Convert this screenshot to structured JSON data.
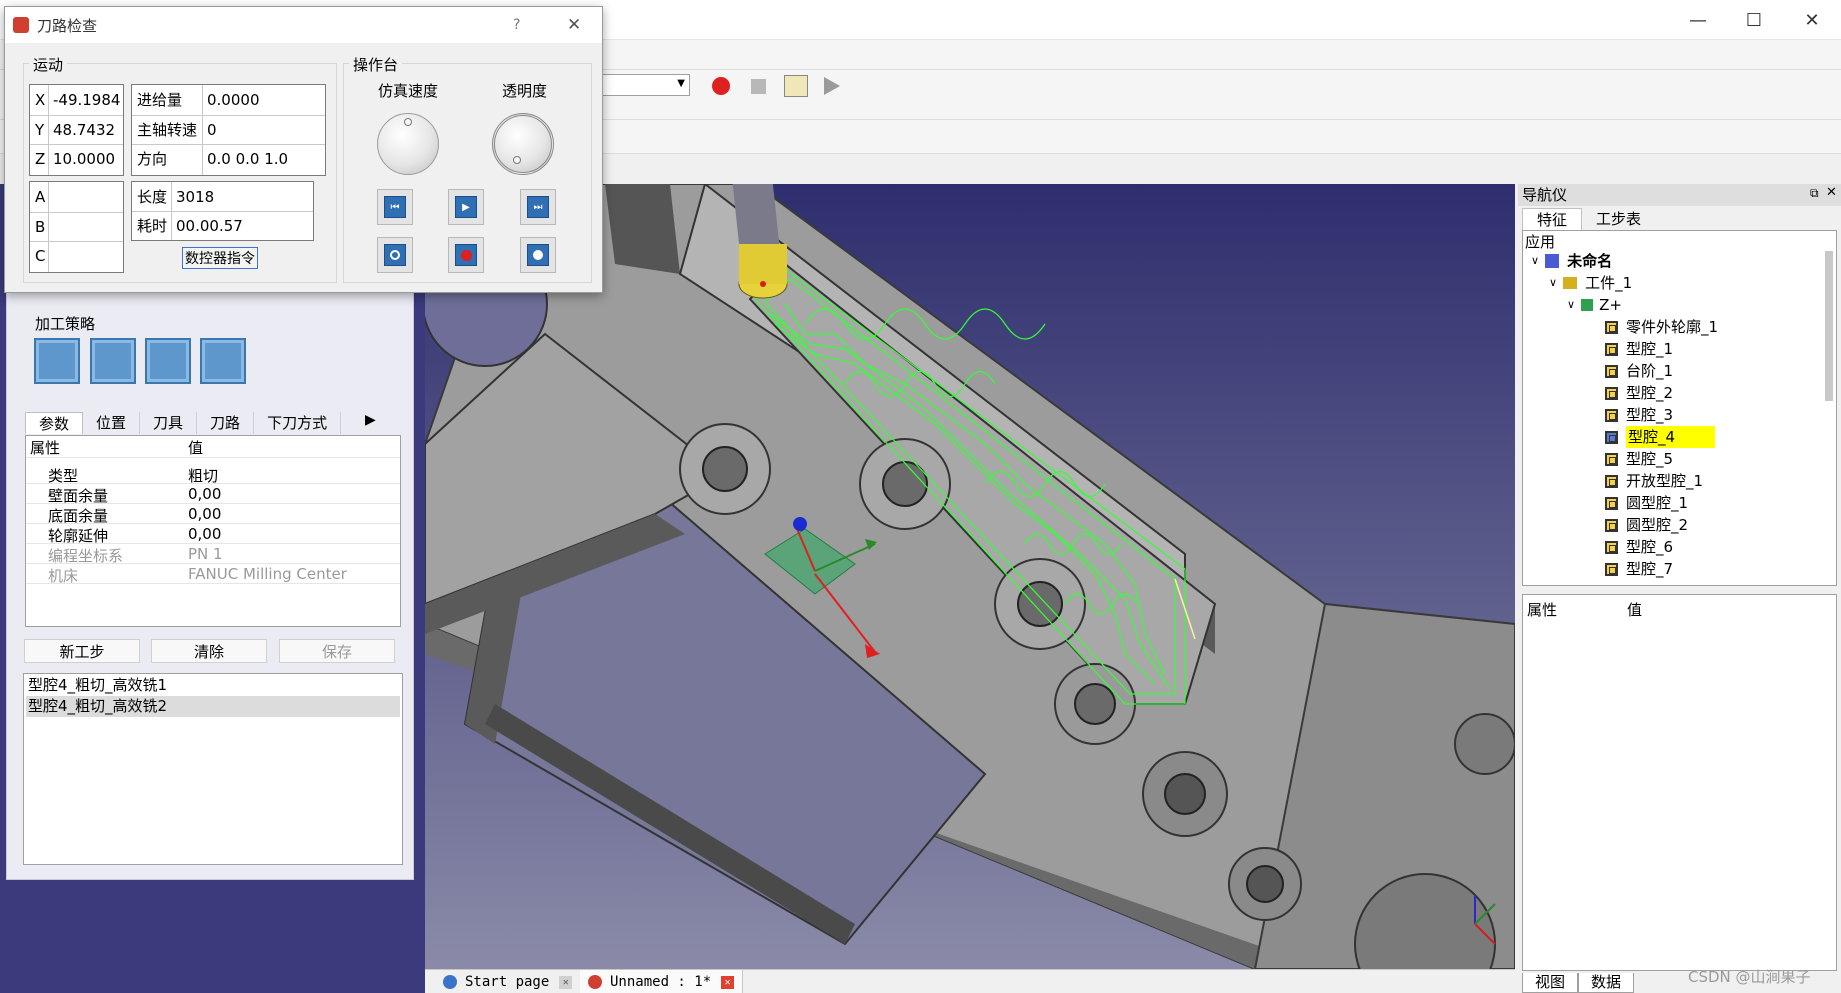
{
  "dialog": {
    "title": "刀路检查",
    "help": "?",
    "close": "✕",
    "motion": {
      "group_label": "运动",
      "x_label": "X",
      "x_value": "-49.1984",
      "y_label": "Y",
      "y_value": "48.7432",
      "z_label": "Z",
      "z_value": "10.0000",
      "a_label": "A",
      "b_label": "B",
      "c_label": "C",
      "feed_label": "进给量",
      "feed_value": "0.0000",
      "spindle_label": "主轴转速",
      "spindle_value": "0",
      "dir_label": "方向",
      "dir_value": "0.0 0.0 1.0",
      "length_label": "长度",
      "length_value": "3018",
      "time_label": "耗时",
      "time_value": "00.00.57",
      "nc_button": "数控器指令"
    },
    "console": {
      "group_label": "操作台",
      "speed_label": "仿真速度",
      "transparency_label": "透明度"
    }
  },
  "left_panel": {
    "strategy_label": "加工策略",
    "tabs": [
      "参数",
      "位置",
      "刀具",
      "刀路",
      "下刀方式"
    ],
    "table_headers": [
      "属性",
      "值"
    ],
    "rows": [
      {
        "name": "类型",
        "value": "粗切"
      },
      {
        "name": "壁面余量",
        "value": "0,00"
      },
      {
        "name": "底面余量",
        "value": "0,00"
      },
      {
        "name": "轮廓延伸",
        "value": "0,00"
      },
      {
        "name": "编程坐标系",
        "value": "PN 1"
      },
      {
        "name": "机床",
        "value": "FANUC Milling Center"
      }
    ],
    "buttons": {
      "new_step": "新工步",
      "clear": "清除",
      "save": "保存"
    },
    "steps": [
      "型腔4_粗切_高效铣1",
      "型腔4_粗切_高效铣2"
    ]
  },
  "viewport_tabs": [
    {
      "label": "Start page"
    },
    {
      "label": "Unnamed : 1*"
    }
  ],
  "navigator": {
    "title": "导航仪",
    "tabs": [
      "特征",
      "工步表"
    ],
    "tree_root": "应用",
    "project": "未命名",
    "workpiece": "工件_1",
    "setup": "Z+",
    "features": [
      "零件外轮廓_1",
      "型腔_1",
      "台阶_1",
      "型腔_2",
      "型腔_3",
      "型腔_4",
      "型腔_5",
      "开放型腔_1",
      "圆型腔_1",
      "圆型腔_2",
      "型腔_6",
      "型腔_7"
    ],
    "selected_feature": "型腔_4",
    "prop_headers": [
      "属性",
      "值"
    ],
    "bottom_tabs": [
      "视图",
      "数据"
    ]
  },
  "watermark": "CSDN @山涧果子",
  "colors": {
    "toolpath": "#33ff33",
    "selection": "#ffff00",
    "record": "#e02020",
    "accent_blue": "#2f6fb3"
  }
}
